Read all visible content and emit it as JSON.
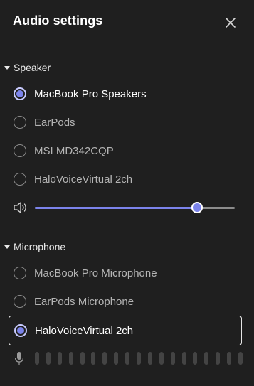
{
  "header": {
    "title": "Audio settings",
    "close_icon": "close-icon"
  },
  "speaker": {
    "section_label": "Speaker",
    "options": [
      {
        "label": "MacBook Pro Speakers",
        "selected": true
      },
      {
        "label": "EarPods",
        "selected": false
      },
      {
        "label": "MSI MD342CQP",
        "selected": false
      },
      {
        "label": "HaloVoiceVirtual 2ch",
        "selected": false
      }
    ],
    "volume_icon": "speaker-volume-icon",
    "volume_fraction": 0.81
  },
  "microphone": {
    "section_label": "Microphone",
    "options": [
      {
        "label": "MacBook Pro Microphone",
        "selected": false
      },
      {
        "label": "EarPods Microphone",
        "selected": false
      },
      {
        "label": "HaloVoiceVirtual 2ch",
        "selected": true
      }
    ],
    "mic_icon": "microphone-icon",
    "level_bar_count": 19,
    "level_active_count": 0
  },
  "colors": {
    "background": "#1f1f1f",
    "accent": "#7b83eb",
    "text_primary": "#ffffff",
    "text_secondary": "#b4b4b4",
    "divider": "#3a3a3a",
    "level_bar_inactive": "#444444"
  }
}
